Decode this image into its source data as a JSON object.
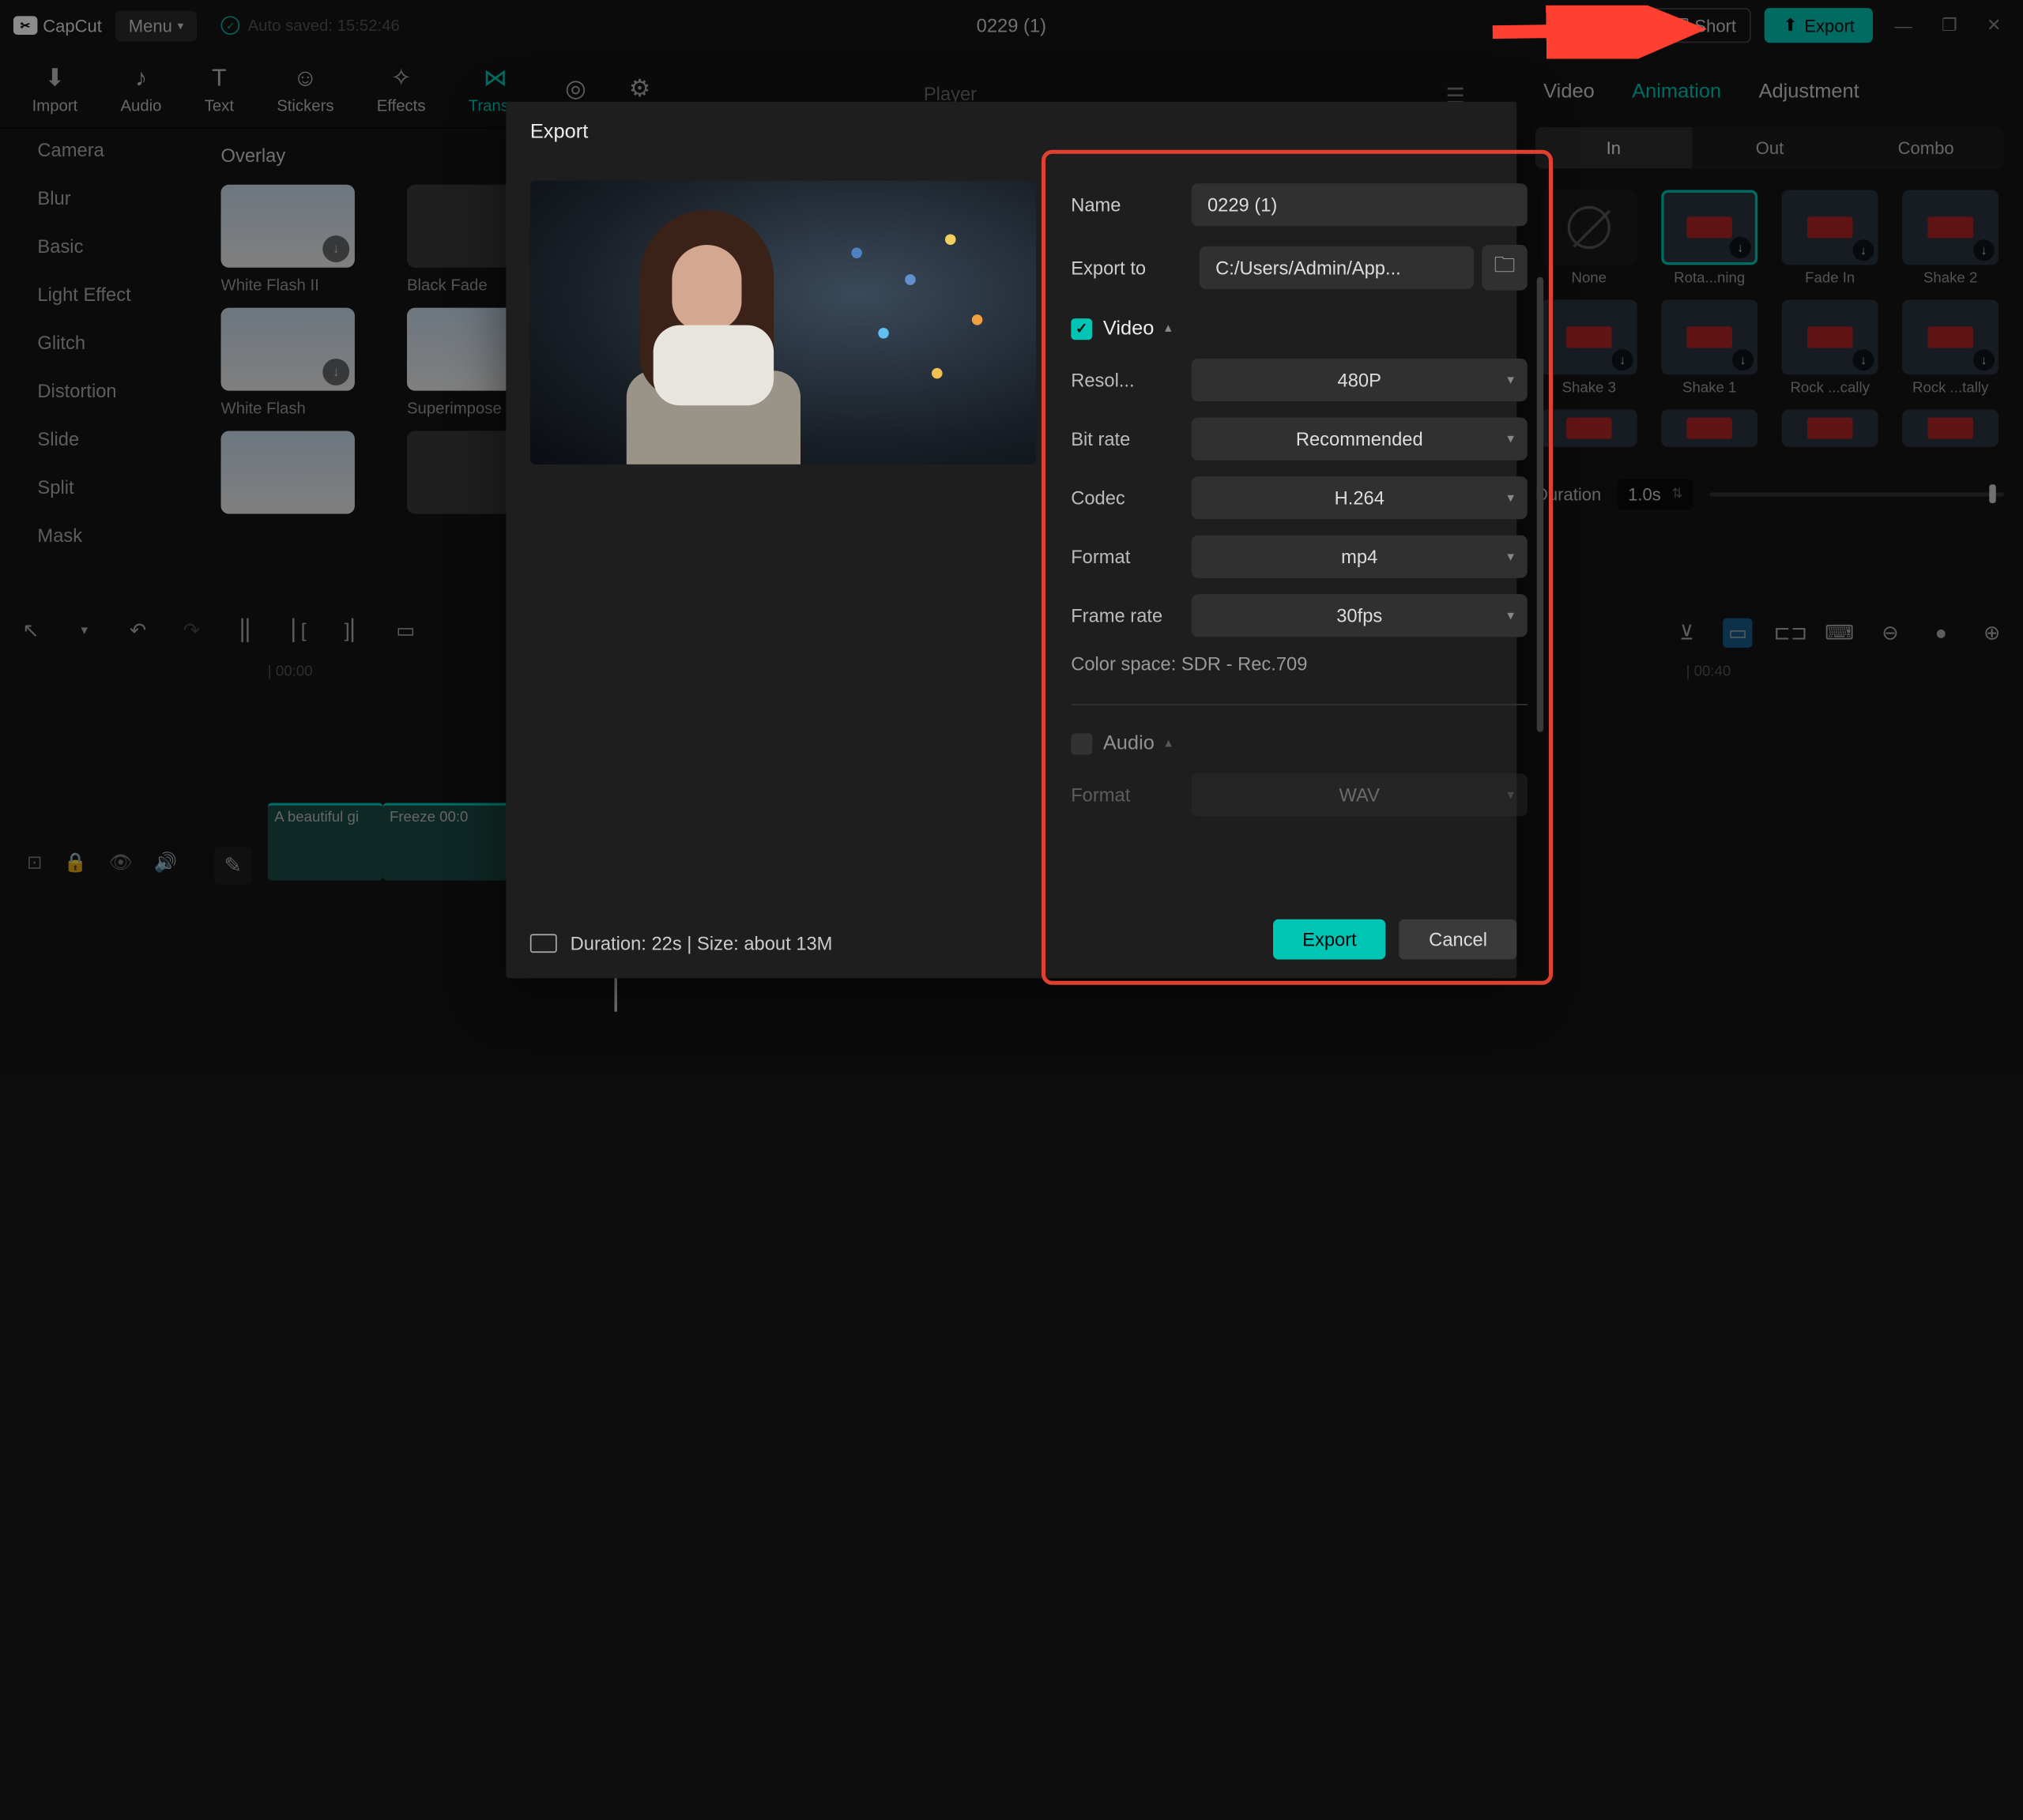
{
  "app_name": "CapCut",
  "header": {
    "menu": "Menu",
    "autosave": "Auto saved: 15:52:46",
    "project_title": "0229 (1)",
    "shortcut": "Short",
    "export": "Export"
  },
  "tool_tabs": {
    "t0": "Import",
    "t1": "Audio",
    "t2": "Text",
    "t3": "Stickers",
    "t4": "Effects",
    "t5": "Trans...",
    "player": "Player"
  },
  "left_categories": {
    "c0": "Camera",
    "c1": "Blur",
    "c2": "Basic",
    "c3": "Light Effect",
    "c4": "Glitch",
    "c5": "Distortion",
    "c6": "Slide",
    "c7": "Split",
    "c8": "Mask"
  },
  "overlay": {
    "title": "Overlay",
    "th0": "White Flash II",
    "th1": "Black Fade",
    "th2": "White Flash",
    "th3": "Superimpose"
  },
  "inspector": {
    "tabs": {
      "video": "Video",
      "animation": "Animation",
      "adjustment": "Adjustment"
    },
    "sub": {
      "in": "In",
      "out": "Out",
      "combo": "Combo"
    },
    "anim": {
      "a0": "None",
      "a1": "Rota...ning",
      "a2": "Fade In",
      "a3": "Shake 2",
      "a4": "Shake 3",
      "a5": "Shake 1",
      "a6": "Rock ...cally",
      "a7": "Rock ...tally"
    },
    "duration_label": "Duration",
    "duration_val": "1.0s"
  },
  "timeline": {
    "t0": "00:00",
    "t1": "00:40",
    "clip1": "A beautiful gi",
    "clip2": "Freeze   00:0"
  },
  "modal": {
    "title": "Export",
    "name_label": "Name",
    "name_val": "0229 (1)",
    "export_to_label": "Export to",
    "export_to_val": "C:/Users/Admin/App...",
    "video_section": "Video",
    "resolution_label": "Resol...",
    "resolution_val": "480P",
    "bitrate_label": "Bit rate",
    "bitrate_val": "Recommended",
    "codec_label": "Codec",
    "codec_val": "H.264",
    "format_label": "Format",
    "format_val": "mp4",
    "framerate_label": "Frame rate",
    "framerate_val": "30fps",
    "colorspace": "Color space: SDR - Rec.709",
    "audio_section": "Audio",
    "audio_format_label": "Format",
    "audio_format_val": "WAV",
    "footer_info": "Duration: 22s | Size: about 13M",
    "export_btn": "Export",
    "cancel_btn": "Cancel"
  }
}
